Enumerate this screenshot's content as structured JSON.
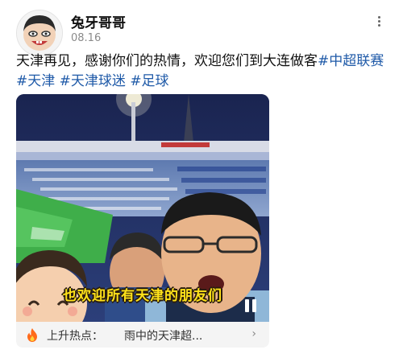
{
  "author": {
    "name": "兔牙哥哥",
    "date": "08.16"
  },
  "post": {
    "text": "天津再见，感谢你们的热情，欢迎您们到大连做客",
    "hashtags": [
      "#中超联赛",
      "#天津",
      "#天津球迷",
      "#足球"
    ]
  },
  "video": {
    "subtitle": "也欢迎所有天津的朋友们"
  },
  "trending": {
    "label": "上升热点：",
    "title": "雨中的天津超..."
  },
  "colors": {
    "hashtag": "#1f5aa8",
    "subtitle": "#ffe21a",
    "trend_icon": "#ff6a1a"
  },
  "icons": {
    "more": "more-vertical-icon",
    "trend": "flame-icon",
    "arrow": "chevron-right-icon",
    "pause": "pause-icon"
  }
}
